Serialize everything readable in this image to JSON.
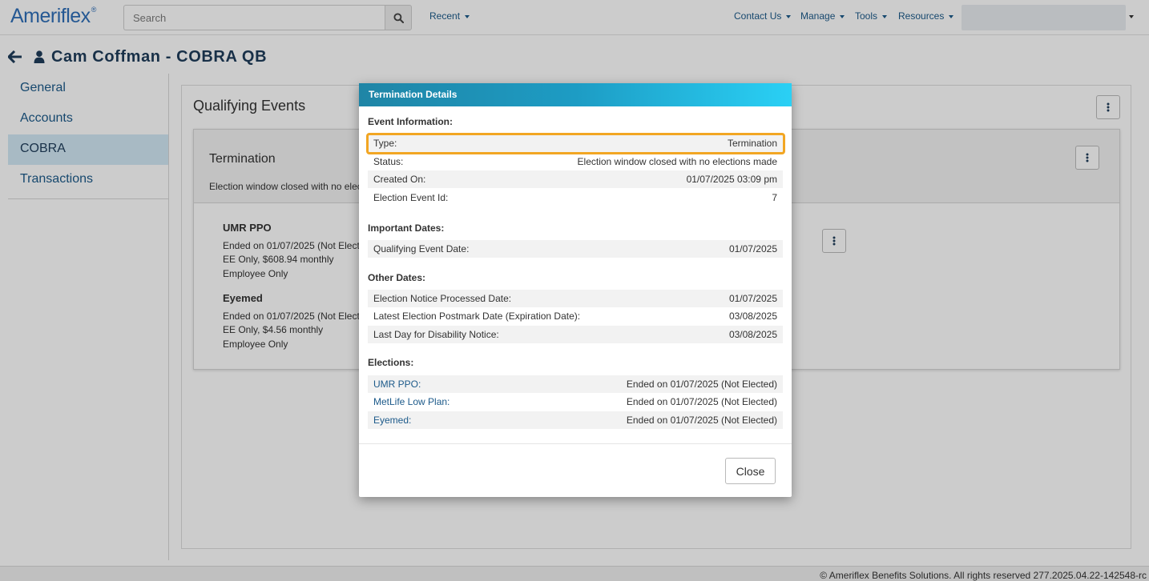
{
  "app": {
    "logo": "Ameriflex",
    "logo_mark": "®"
  },
  "topbar": {
    "search_placeholder": "Search",
    "recent_label": "Recent",
    "contact_label": "Contact Us",
    "manage_label": "Manage",
    "tools_label": "Tools",
    "resources_label": "Resources"
  },
  "page": {
    "title": "Cam Coffman - COBRA QB"
  },
  "sidebar": {
    "items": [
      {
        "label": "General"
      },
      {
        "label": "Accounts"
      },
      {
        "label": "COBRA"
      },
      {
        "label": "Transactions"
      }
    ],
    "active_index": 2
  },
  "main": {
    "title": "Qualifying Events",
    "card": {
      "title": "Termination",
      "subtitle": "Election window closed with no elect",
      "plans": [
        {
          "name": "UMR PPO",
          "lines": [
            "Ended on 01/07/2025 (Not Electe",
            "EE Only, $608.94 monthly",
            "Employee Only"
          ]
        },
        {
          "name": "Eyemed",
          "lines": [
            "Ended on 01/07/2025 (Not Electe",
            "EE Only, $4.56 monthly",
            "Employee Only"
          ]
        }
      ]
    }
  },
  "modal": {
    "title": "Termination Details",
    "sections": {
      "event_info": "Event Information:",
      "important_dates": "Important Dates:",
      "other_dates": "Other Dates:",
      "elections": "Elections:"
    },
    "event_info": [
      {
        "label": "Type:",
        "value": "Termination"
      },
      {
        "label": "Status:",
        "value": "Election window closed with no elections made"
      },
      {
        "label": "Created On:",
        "value": "01/07/2025 03:09 pm"
      },
      {
        "label": "Election Event Id:",
        "value": "7"
      }
    ],
    "important_dates": [
      {
        "label": "Qualifying Event Date:",
        "value": "01/07/2025"
      }
    ],
    "other_dates": [
      {
        "label": "Election Notice Processed Date:",
        "value": "01/07/2025"
      },
      {
        "label": "Latest Election Postmark Date (Expiration Date):",
        "value": "03/08/2025"
      },
      {
        "label": "Last Day for Disability Notice:",
        "value": "03/08/2025"
      }
    ],
    "elections": [
      {
        "label": "UMR PPO:",
        "value": "Ended on 01/07/2025 (Not Elected)"
      },
      {
        "label": "MetLife Low Plan:",
        "value": "Ended on 01/07/2025 (Not Elected)"
      },
      {
        "label": "Eyemed:",
        "value": "Ended on 01/07/2025 (Not Elected)"
      }
    ],
    "close_label": "Close"
  },
  "footer": {
    "text": "© Ameriflex Benefits Solutions. All rights reserved 277.2025.04.22-142548-rc"
  },
  "colors": {
    "accent": "#1c5a8a",
    "header_gradient_start": "#1f85a6",
    "header_gradient_end": "#2ad0f5",
    "highlight": "#f2a623",
    "active_nav": "#d2e9f6"
  }
}
